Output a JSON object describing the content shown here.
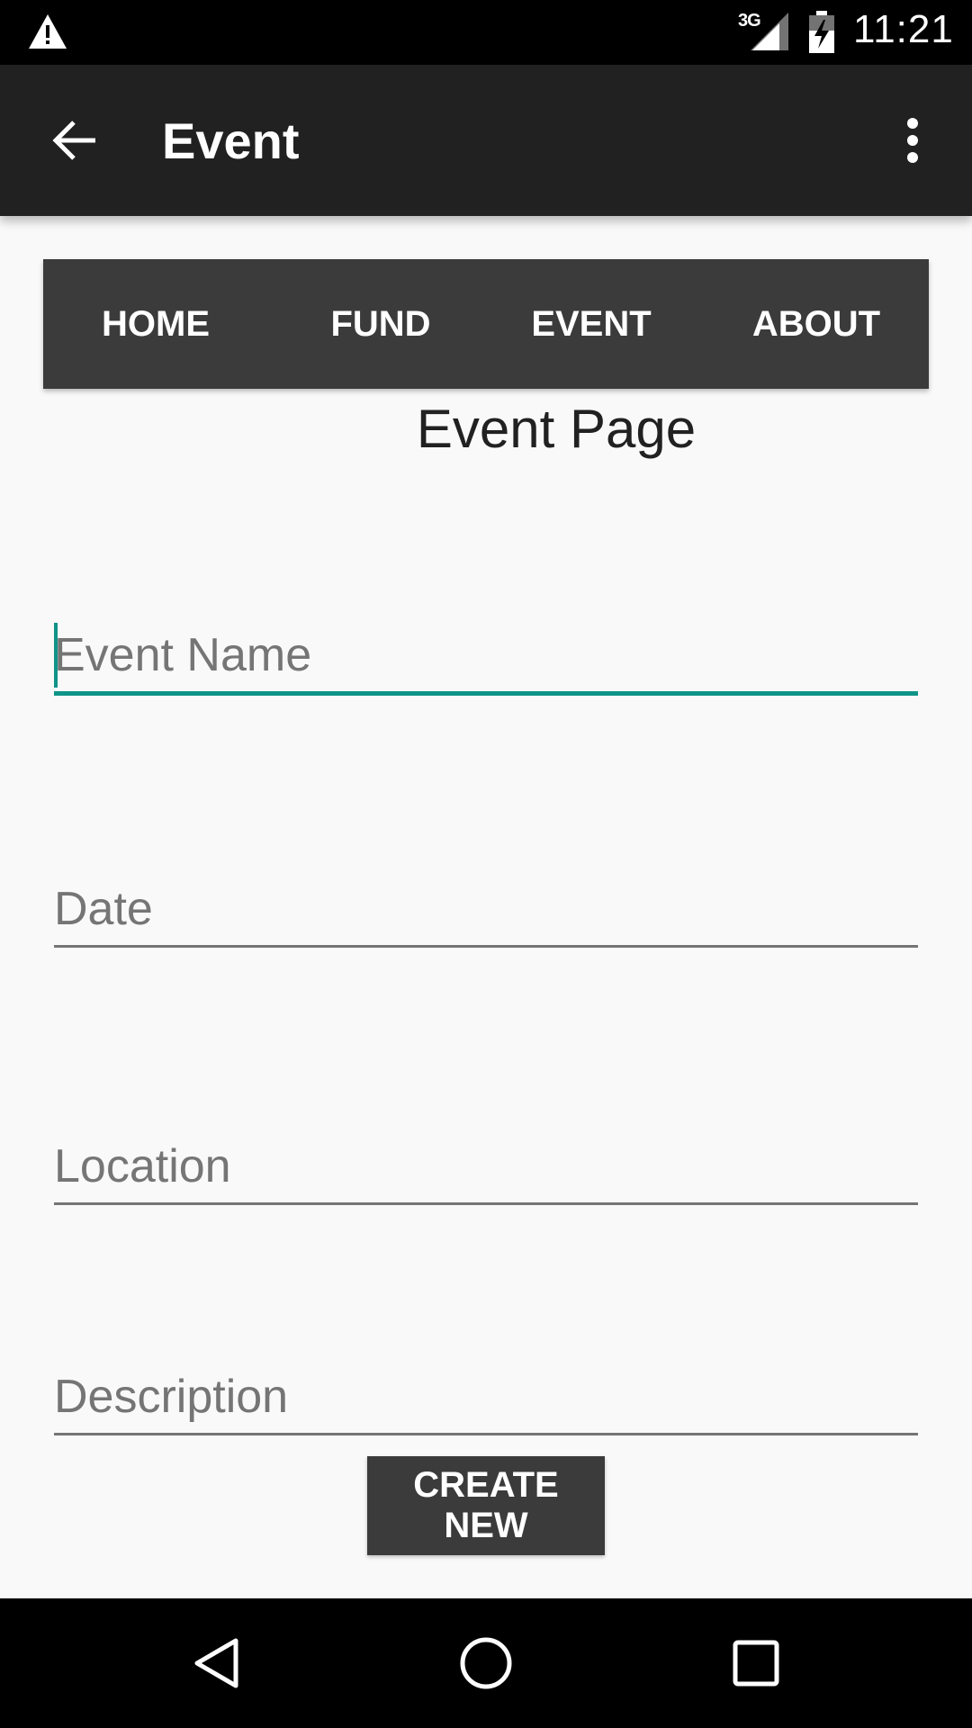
{
  "status_bar": {
    "time": "11:21",
    "network": "3G",
    "icons": [
      "warning-icon",
      "signal-icon",
      "battery-charging-icon"
    ]
  },
  "app_bar": {
    "title": "Event",
    "icons": [
      "back-arrow-icon",
      "more-vert-icon"
    ]
  },
  "tabs": [
    {
      "label": "HOME"
    },
    {
      "label": "FUND"
    },
    {
      "label": "EVENT"
    },
    {
      "label": "ABOUT"
    }
  ],
  "page": {
    "heading": "Event Page"
  },
  "form": {
    "event_name": {
      "placeholder": "Event Name",
      "value": "",
      "focused": true
    },
    "date": {
      "placeholder": "Date",
      "value": ""
    },
    "location": {
      "placeholder": "Location",
      "value": ""
    },
    "description": {
      "placeholder": "Description",
      "value": ""
    },
    "submit_label": "CREATE NEW"
  },
  "nav_bar": {
    "icons": [
      "nav-back-icon",
      "nav-home-icon",
      "nav-recents-icon"
    ]
  },
  "colors": {
    "accent": "#0f9488",
    "app_bar": "#212121",
    "tab_bar": "#3b3b3b",
    "background": "#f9f9f9"
  }
}
